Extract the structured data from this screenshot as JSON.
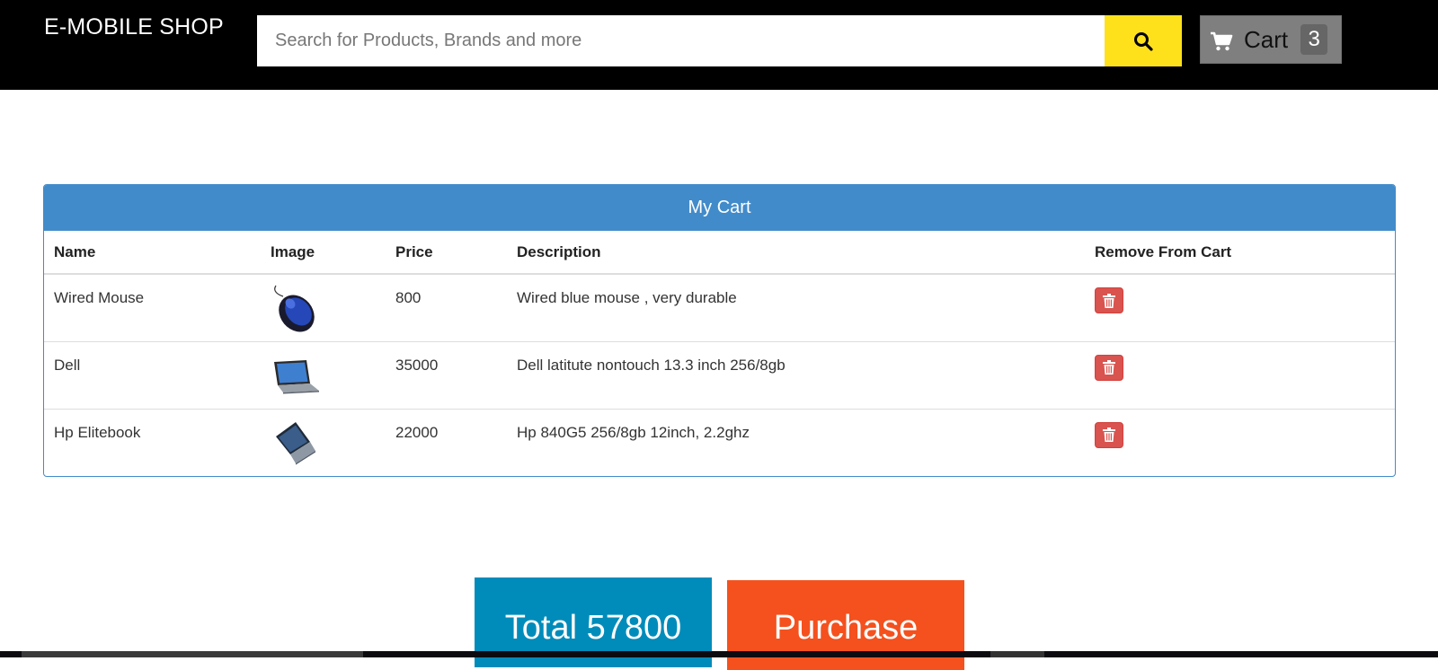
{
  "header": {
    "brand": "E-MOBILE SHOP",
    "search": {
      "placeholder": "Search for Products, Brands and more",
      "value": ""
    },
    "search_icon": "search-icon",
    "cart": {
      "label": "Cart",
      "count": "3",
      "icon": "cart-icon"
    }
  },
  "cart_panel": {
    "title": "My Cart",
    "columns": [
      "Name",
      "Image",
      "Price",
      "Description",
      "Remove From Cart"
    ],
    "rows": [
      {
        "name": "Wired Mouse",
        "image": "mouse-image",
        "price": "800",
        "description": "Wired blue mouse , very durable",
        "remove_icon": "trash-icon"
      },
      {
        "name": "Dell",
        "image": "laptop-image",
        "price": "35000",
        "description": "Dell latitute nontouch 13.3 inch 256/8gb",
        "remove_icon": "trash-icon"
      },
      {
        "name": "Hp Elitebook",
        "image": "laptop-image",
        "price": "22000",
        "description": "Hp 840G5 256/8gb 12inch, 2.2ghz",
        "remove_icon": "trash-icon"
      }
    ]
  },
  "actions": {
    "total_label": "Total 57800",
    "purchase_label": "Purchase"
  },
  "colors": {
    "header_bg": "#000000",
    "search_button": "#ffe11b",
    "cart_button": "#7f7f7f",
    "panel_accent": "#428bca",
    "remove_button": "#d9534f",
    "total_button": "#008cba",
    "purchase_button": "#f4511e"
  }
}
